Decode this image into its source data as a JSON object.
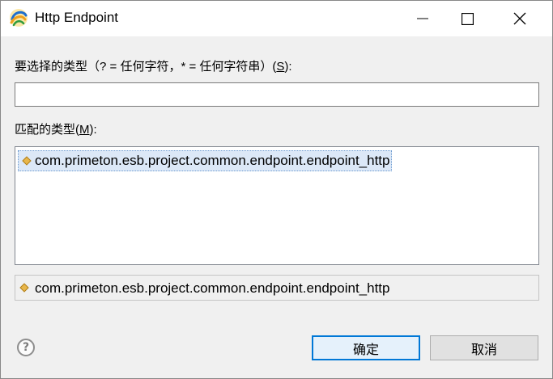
{
  "window": {
    "title": "Http Endpoint",
    "icon": "eclipse-style-swirl-icon",
    "controls": [
      "minimize-icon",
      "maximize-icon",
      "close-icon"
    ]
  },
  "search": {
    "label_prefix": "要选择的类型（? = 任何字符，* = 任何字符串）(",
    "label_mnemonic": "S",
    "label_suffix": "):",
    "value": ""
  },
  "matches": {
    "label_prefix": "匹配的类型(",
    "label_mnemonic": "M",
    "label_suffix": "):",
    "items": [
      {
        "text": "com.primeton.esb.project.common.endpoint.endpoint_http",
        "selected": true
      }
    ]
  },
  "status": {
    "text": "com.primeton.esb.project.common.endpoint.endpoint_http"
  },
  "buttons": {
    "help": "?",
    "ok": "确定",
    "cancel": "取消"
  },
  "colors": {
    "selection_bg": "#dce8f7",
    "default_button_border": "#0078d7",
    "dialog_bg": "#f0f0f0",
    "type_icon": "#e8b64a"
  }
}
